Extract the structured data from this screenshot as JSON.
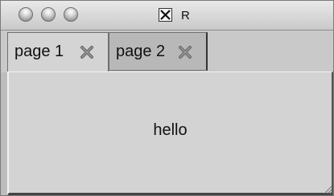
{
  "window": {
    "title": "R",
    "icon": "x11-icon"
  },
  "tabs": [
    {
      "label": "page 1",
      "selected": true,
      "close_icon": "close-icon"
    },
    {
      "label": "page 2",
      "selected": false,
      "close_icon": "close-icon"
    }
  ],
  "content": {
    "text": "hello"
  }
}
